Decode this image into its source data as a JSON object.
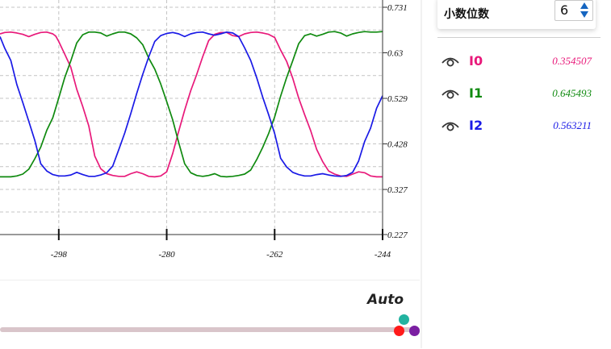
{
  "chart_data": {
    "type": "line",
    "x_ticks": [
      -298,
      -280,
      -262,
      -244
    ],
    "y_ticks": [
      0.731,
      0.63,
      0.529,
      0.428,
      0.327,
      0.227
    ],
    "x_tick_labels": [
      "-298",
      "-280",
      "-262",
      "-244"
    ],
    "y_tick_labels": [
      "0.731",
      "0.63",
      "0.529",
      "0.428",
      "0.327",
      "0.227"
    ],
    "xlim": [
      -307.8,
      -244
    ],
    "ylim": [
      0.227,
      0.731
    ],
    "grid": true,
    "series": [
      {
        "name": "I0",
        "color": "#e8197a",
        "points": [
          [
            -307.8,
            0.672
          ],
          [
            -307,
            0.675
          ],
          [
            -306,
            0.676
          ],
          [
            -305,
            0.674
          ],
          [
            -304,
            0.671
          ],
          [
            -303,
            0.666
          ],
          [
            -302,
            0.671
          ],
          [
            -301,
            0.675
          ],
          [
            -300,
            0.676
          ],
          [
            -299.5,
            0.674
          ],
          [
            -299,
            0.672
          ],
          [
            -298.5,
            0.667
          ],
          [
            -298,
            0.655
          ],
          [
            -297,
            0.627
          ],
          [
            -296,
            0.598
          ],
          [
            -295,
            0.549
          ],
          [
            -294,
            0.511
          ],
          [
            -293,
            0.468
          ],
          [
            -292,
            0.401
          ],
          [
            -291,
            0.373
          ],
          [
            -290,
            0.362
          ],
          [
            -289,
            0.358
          ],
          [
            -288,
            0.356
          ],
          [
            -287,
            0.356
          ],
          [
            -286,
            0.362
          ],
          [
            -285,
            0.366
          ],
          [
            -284,
            0.362
          ],
          [
            -283,
            0.356
          ],
          [
            -282,
            0.355
          ],
          [
            -281,
            0.357
          ],
          [
            -280,
            0.366
          ],
          [
            -279,
            0.407
          ],
          [
            -278,
            0.456
          ],
          [
            -277,
            0.503
          ],
          [
            -276,
            0.546
          ],
          [
            -275,
            0.582
          ],
          [
            -274,
            0.621
          ],
          [
            -273,
            0.657
          ],
          [
            -272,
            0.671
          ],
          [
            -271,
            0.675
          ],
          [
            -270,
            0.675
          ],
          [
            -269,
            0.668
          ],
          [
            -268,
            0.666
          ],
          [
            -267,
            0.672
          ],
          [
            -266,
            0.675
          ],
          [
            -265,
            0.676
          ],
          [
            -264,
            0.674
          ],
          [
            -263,
            0.671
          ],
          [
            -262,
            0.664
          ],
          [
            -261,
            0.636
          ],
          [
            -260,
            0.611
          ],
          [
            -259,
            0.574
          ],
          [
            -258,
            0.53
          ],
          [
            -257,
            0.493
          ],
          [
            -256,
            0.458
          ],
          [
            -255,
            0.416
          ],
          [
            -254,
            0.389
          ],
          [
            -253,
            0.368
          ],
          [
            -252,
            0.361
          ],
          [
            -251,
            0.357
          ],
          [
            -250,
            0.356
          ],
          [
            -249,
            0.361
          ],
          [
            -248,
            0.366
          ],
          [
            -247,
            0.364
          ],
          [
            -246,
            0.357
          ],
          [
            -245,
            0.355
          ],
          [
            -244,
            0.355
          ]
        ]
      },
      {
        "name": "I1",
        "color": "#0f8a0f",
        "points": [
          [
            -307.8,
            0.355
          ],
          [
            -306,
            0.355
          ],
          [
            -305,
            0.357
          ],
          [
            -304,
            0.361
          ],
          [
            -303,
            0.372
          ],
          [
            -302,
            0.395
          ],
          [
            -301,
            0.421
          ],
          [
            -300,
            0.458
          ],
          [
            -299,
            0.486
          ],
          [
            -298,
            0.53
          ],
          [
            -297,
            0.575
          ],
          [
            -296,
            0.612
          ],
          [
            -295,
            0.652
          ],
          [
            -294,
            0.67
          ],
          [
            -293,
            0.676
          ],
          [
            -292,
            0.676
          ],
          [
            -291,
            0.674
          ],
          [
            -290,
            0.667
          ],
          [
            -289,
            0.672
          ],
          [
            -288,
            0.676
          ],
          [
            -287,
            0.676
          ],
          [
            -286,
            0.672
          ],
          [
            -285,
            0.663
          ],
          [
            -284,
            0.648
          ],
          [
            -283,
            0.618
          ],
          [
            -282,
            0.594
          ],
          [
            -281,
            0.561
          ],
          [
            -280,
            0.522
          ],
          [
            -279,
            0.481
          ],
          [
            -278,
            0.431
          ],
          [
            -277,
            0.384
          ],
          [
            -276,
            0.364
          ],
          [
            -275,
            0.358
          ],
          [
            -274,
            0.356
          ],
          [
            -273,
            0.358
          ],
          [
            -272,
            0.362
          ],
          [
            -271,
            0.356
          ],
          [
            -270,
            0.355
          ],
          [
            -269,
            0.356
          ],
          [
            -268,
            0.358
          ],
          [
            -267,
            0.361
          ],
          [
            -266,
            0.37
          ],
          [
            -265,
            0.393
          ],
          [
            -264,
            0.42
          ],
          [
            -263,
            0.451
          ],
          [
            -262,
            0.488
          ],
          [
            -261,
            0.534
          ],
          [
            -260,
            0.575
          ],
          [
            -259,
            0.612
          ],
          [
            -258,
            0.65
          ],
          [
            -257,
            0.668
          ],
          [
            -256,
            0.672
          ],
          [
            -255,
            0.667
          ],
          [
            -254,
            0.671
          ],
          [
            -253,
            0.676
          ],
          [
            -252,
            0.677
          ],
          [
            -251,
            0.674
          ],
          [
            -250,
            0.667
          ],
          [
            -249,
            0.672
          ],
          [
            -248,
            0.675
          ],
          [
            -247,
            0.677
          ],
          [
            -246,
            0.676
          ],
          [
            -245,
            0.676
          ],
          [
            -244,
            0.677
          ]
        ]
      },
      {
        "name": "I2",
        "color": "#1a1ae6",
        "points": [
          [
            -307.8,
            0.666
          ],
          [
            -307,
            0.64
          ],
          [
            -306,
            0.613
          ],
          [
            -305,
            0.56
          ],
          [
            -304,
            0.52
          ],
          [
            -303,
            0.478
          ],
          [
            -302,
            0.436
          ],
          [
            -301,
            0.384
          ],
          [
            -300,
            0.368
          ],
          [
            -299,
            0.36
          ],
          [
            -298,
            0.357
          ],
          [
            -297,
            0.357
          ],
          [
            -296,
            0.359
          ],
          [
            -295,
            0.365
          ],
          [
            -294,
            0.36
          ],
          [
            -293,
            0.356
          ],
          [
            -292,
            0.356
          ],
          [
            -291,
            0.359
          ],
          [
            -290,
            0.364
          ],
          [
            -289,
            0.379
          ],
          [
            -288,
            0.415
          ],
          [
            -287,
            0.452
          ],
          [
            -286,
            0.495
          ],
          [
            -285,
            0.54
          ],
          [
            -284,
            0.582
          ],
          [
            -283,
            0.621
          ],
          [
            -282,
            0.655
          ],
          [
            -281,
            0.668
          ],
          [
            -280,
            0.673
          ],
          [
            -279,
            0.675
          ],
          [
            -278,
            0.672
          ],
          [
            -277,
            0.666
          ],
          [
            -276,
            0.672
          ],
          [
            -275,
            0.675
          ],
          [
            -274,
            0.676
          ],
          [
            -273,
            0.672
          ],
          [
            -272,
            0.669
          ],
          [
            -271,
            0.672
          ],
          [
            -270,
            0.676
          ],
          [
            -269,
            0.674
          ],
          [
            -268,
            0.666
          ],
          [
            -267,
            0.641
          ],
          [
            -266,
            0.613
          ],
          [
            -265,
            0.575
          ],
          [
            -264,
            0.532
          ],
          [
            -263,
            0.493
          ],
          [
            -262,
            0.451
          ],
          [
            -261,
            0.396
          ],
          [
            -260,
            0.377
          ],
          [
            -259,
            0.365
          ],
          [
            -258,
            0.36
          ],
          [
            -257,
            0.357
          ],
          [
            -256,
            0.357
          ],
          [
            -255,
            0.36
          ],
          [
            -254,
            0.362
          ],
          [
            -253,
            0.359
          ],
          [
            -252,
            0.357
          ],
          [
            -251,
            0.356
          ],
          [
            -250,
            0.358
          ],
          [
            -249,
            0.365
          ],
          [
            -248,
            0.39
          ],
          [
            -247,
            0.433
          ],
          [
            -246,
            0.463
          ],
          [
            -245,
            0.507
          ],
          [
            -244,
            0.535
          ]
        ]
      }
    ]
  },
  "settings": {
    "decimal_label": "小数位数",
    "decimal_value": "6"
  },
  "legend": {
    "items": [
      {
        "name": "I0",
        "value": "0.354507",
        "color": "#e8197a",
        "icon": "eye-icon"
      },
      {
        "name": "I1",
        "value": "0.645493",
        "color": "#0f8a0f",
        "icon": "eye-icon"
      },
      {
        "name": "I2",
        "value": "0.563211",
        "color": "#1a1ae6",
        "icon": "eye-icon"
      }
    ]
  },
  "timeline": {
    "mode_label": "Auto",
    "marker_colors": [
      "#22b3a0",
      "#ff1a1a",
      "#7b1fa2"
    ]
  }
}
